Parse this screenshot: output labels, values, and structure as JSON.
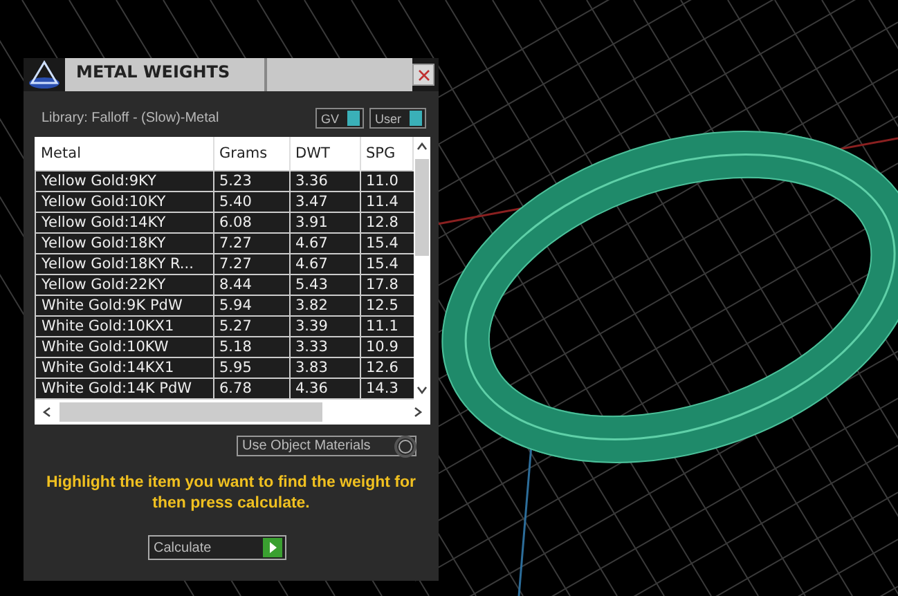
{
  "window": {
    "title": "METAL WEIGHTS"
  },
  "library": "Library: Falloff - (Slow)-Metal",
  "toggles": [
    {
      "label": "GV",
      "on": true
    },
    {
      "label": "User",
      "on": true
    }
  ],
  "table": {
    "columns": [
      "Metal",
      "Grams",
      "DWT",
      "SPG"
    ],
    "rows": [
      [
        "Yellow Gold:9KY",
        "5.23",
        "3.36",
        "11.0"
      ],
      [
        "Yellow Gold:10KY",
        "5.40",
        "3.47",
        "11.4"
      ],
      [
        "Yellow Gold:14KY",
        "6.08",
        "3.91",
        "12.8"
      ],
      [
        "Yellow Gold:18KY",
        "7.27",
        "4.67",
        "15.4"
      ],
      [
        "Yellow Gold:18KY R...",
        "7.27",
        "4.67",
        "15.4"
      ],
      [
        "Yellow Gold:22KY",
        "8.44",
        "5.43",
        "17.8"
      ],
      [
        "White Gold:9K PdW",
        "5.94",
        "3.82",
        "12.5"
      ],
      [
        "White Gold:10KX1",
        "5.27",
        "3.39",
        "11.1"
      ],
      [
        "White Gold:10KW",
        "5.18",
        "3.33",
        "10.9"
      ],
      [
        "White Gold:14KX1",
        "5.95",
        "3.83",
        "12.6"
      ],
      [
        "White Gold:14K PdW",
        "6.78",
        "4.36",
        "14.3"
      ]
    ]
  },
  "use_object_materials": {
    "label": "Use Object Materials",
    "checked": false
  },
  "hint": "Highlight the item you want to find the weight for then press calculate.",
  "calculate_button": "Calculate"
}
